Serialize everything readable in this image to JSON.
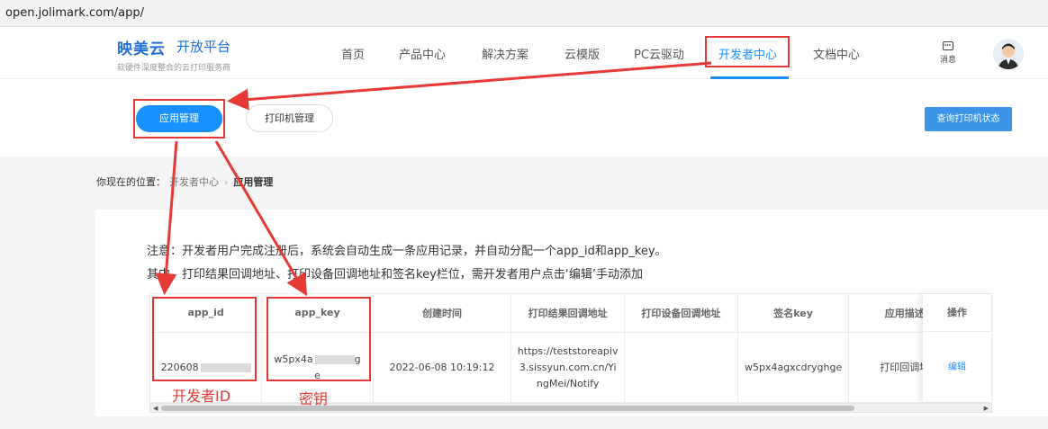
{
  "browser": {
    "url": "open.jolimark.com/app/"
  },
  "brand": {
    "logo": "映美云",
    "platform": "开放平台",
    "slogan": "软硬件深度整合的云打印服务商"
  },
  "nav": {
    "items": [
      {
        "label": "首页"
      },
      {
        "label": "产品中心"
      },
      {
        "label": "解决方案"
      },
      {
        "label": "云模版"
      },
      {
        "label": "PC云驱动"
      },
      {
        "label": "开发者中心",
        "active": true
      },
      {
        "label": "文档中心"
      }
    ],
    "message_label": "消息"
  },
  "subnav": {
    "app_manage": "应用管理",
    "printer_manage": "打印机管理",
    "query_status": "查询打印机状态"
  },
  "breadcrumb": {
    "prefix": "你现在的位置：",
    "parent": "开发者中心",
    "separator": "›",
    "current": "应用管理"
  },
  "notes": [
    "注意：开发者用户完成注册后，系统会自动生成一条应用记录，并自动分配一个app_id和app_key。",
    "其中，打印结果回调地址、打印设备回调地址和签名key栏位，需开发者用户点击‘编辑’手动添加"
  ],
  "table": {
    "headers": [
      "app_id",
      "app_key",
      "创建时间",
      "打印结果回调地址",
      "打印设备回调地址",
      "签名key",
      "应用描述"
    ],
    "row": {
      "app_id": "220608",
      "app_key_prefix": "w5px4a",
      "app_key_suffix": "g",
      "app_key_tail": "e",
      "created": "2022-06-08 10:19:12",
      "result_callback": "https://teststoreapiv3.sissyun.com.cn/YingMei/Notify",
      "device_callback": "",
      "sign_key": "w5px4agxcdryghge",
      "desc": "打印回调地"
    },
    "op_header": "操作",
    "op_edit": "编辑"
  },
  "annotations": {
    "developer_id": "开发者ID",
    "secret_key": "密钥"
  },
  "colors": {
    "primary": "#1890ff",
    "annotation": "#e53935"
  }
}
